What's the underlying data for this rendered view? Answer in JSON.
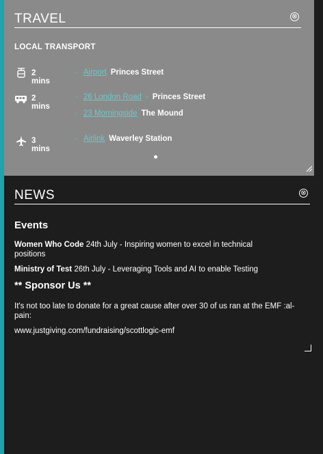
{
  "travel": {
    "title": "TRAVEL",
    "close_icon": "⊗",
    "section_label": "LOCAL TRANSPORT",
    "groups": [
      {
        "icon": "tram-icon",
        "time": "2 mins",
        "routes": [
          {
            "service": "Airport",
            "destination": "Princes Street"
          }
        ]
      },
      {
        "icon": "bus-icon",
        "time": "2 mins",
        "routes": [
          {
            "service": "26 London Road",
            "destination": "Princes Street"
          },
          {
            "service": "23 Morningside",
            "destination": "The Mound"
          }
        ]
      },
      {
        "icon": "airplane-icon",
        "time": "3 mins",
        "routes": [
          {
            "service": "Airlink",
            "destination": "Waverley Station"
          }
        ]
      }
    ]
  },
  "news": {
    "title": "NEWS",
    "close_icon": "⊗",
    "events_title": "Events",
    "events": [
      {
        "name": "Women Who Code",
        "text": " 24th July - Inspiring women to excel in technical positions"
      },
      {
        "name": "Ministry of Test",
        "text": " 26th July - Leveraging Tools and AI to enable Testing"
      }
    ],
    "sponsor_title": "** Sponsor Us **",
    "sponsor_text": "It's not too late to donate for a great cause after over 30 of us ran at the EMF :al-pain:",
    "sponsor_link": "www.justgiving.com/fundraising/scottlogic-emf"
  },
  "colors": {
    "accent": "#1fa3ad",
    "travel_bg": "#8a8a8a",
    "news_bg": "#1d1d1d",
    "link": "#6ec7c6"
  }
}
